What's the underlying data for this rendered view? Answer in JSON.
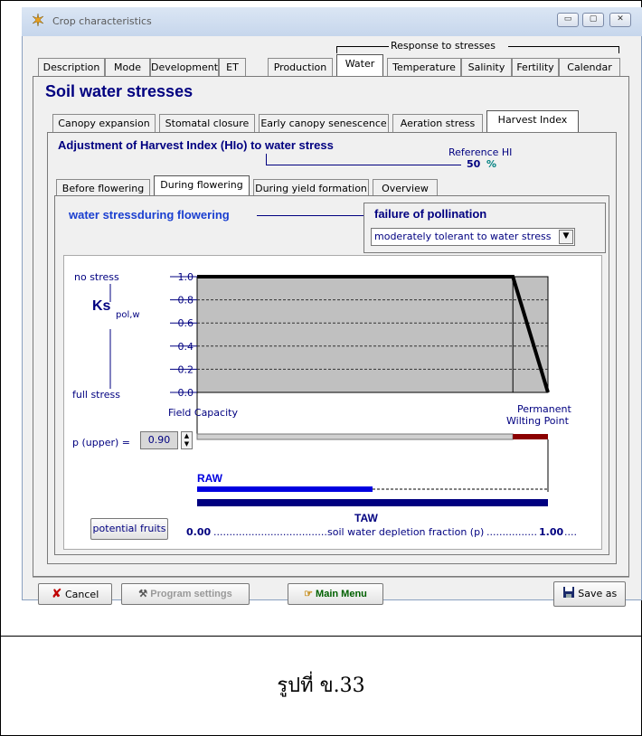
{
  "window": {
    "title": "Crop characteristics"
  },
  "response_group_label": "Response to stresses",
  "main_tabs": [
    {
      "label": "Description"
    },
    {
      "label": "Mode"
    },
    {
      "label": "Development"
    },
    {
      "label": "ET"
    },
    {
      "label": "Production"
    },
    {
      "label": "Water"
    },
    {
      "label": "Temperature"
    },
    {
      "label": "Salinity"
    },
    {
      "label": "Fertility"
    },
    {
      "label": "Calendar"
    }
  ],
  "heading": "Soil water stresses",
  "stress_tabs": [
    {
      "label": "Canopy expansion"
    },
    {
      "label": "Stomatal closure"
    },
    {
      "label": "Early canopy senescence"
    },
    {
      "label": "Aeration stress"
    },
    {
      "label": "Harvest Index"
    }
  ],
  "hi_heading": "Adjustment of Harvest Index (HIo) to water stress",
  "reference_hi": {
    "label": "Reference HI",
    "value": "50",
    "unit": "%"
  },
  "phase_tabs": [
    {
      "label": "Before flowering"
    },
    {
      "label": "During flowering"
    },
    {
      "label": "During yield formation"
    },
    {
      "label": "Overview"
    }
  ],
  "water_stress_label": "water stressduring flowering",
  "failure_label": "failure of pollination",
  "tolerance_select": {
    "value": "moderately tolerant to water stress"
  },
  "graph": {
    "no_stress": "no stress",
    "full_stress": "full stress",
    "ks_label": "Ks",
    "ks_sub": "pol,w",
    "y_ticks": [
      "1.0",
      "0.8",
      "0.6",
      "0.4",
      "0.2",
      "0.0"
    ],
    "field_capacity": "Field Capacity",
    "pwp_line1": "Permanent",
    "pwp_line2": "Wilting Point",
    "raw_label": "RAW",
    "taw_label": "TAW",
    "x_start": "0.00",
    "x_axis_text": "soil water depletion fraction (p)",
    "x_end": "1.00"
  },
  "chart_data": {
    "type": "line",
    "x": [
      0.0,
      0.9,
      1.0
    ],
    "y": [
      1.0,
      1.0,
      0.0
    ],
    "ylim": [
      0,
      1
    ],
    "xlim": [
      0,
      1
    ],
    "grid": true
  },
  "p_upper": {
    "label": "p (upper) =",
    "value": "0.90"
  },
  "raw_fraction": 0.5,
  "buttons": {
    "potential_fruits": "potential fruits",
    "cancel": "Cancel",
    "program_settings": "Program settings",
    "main_menu": "Main Menu",
    "save_as": "Save as"
  },
  "caption": "รูปที่ ข.33"
}
